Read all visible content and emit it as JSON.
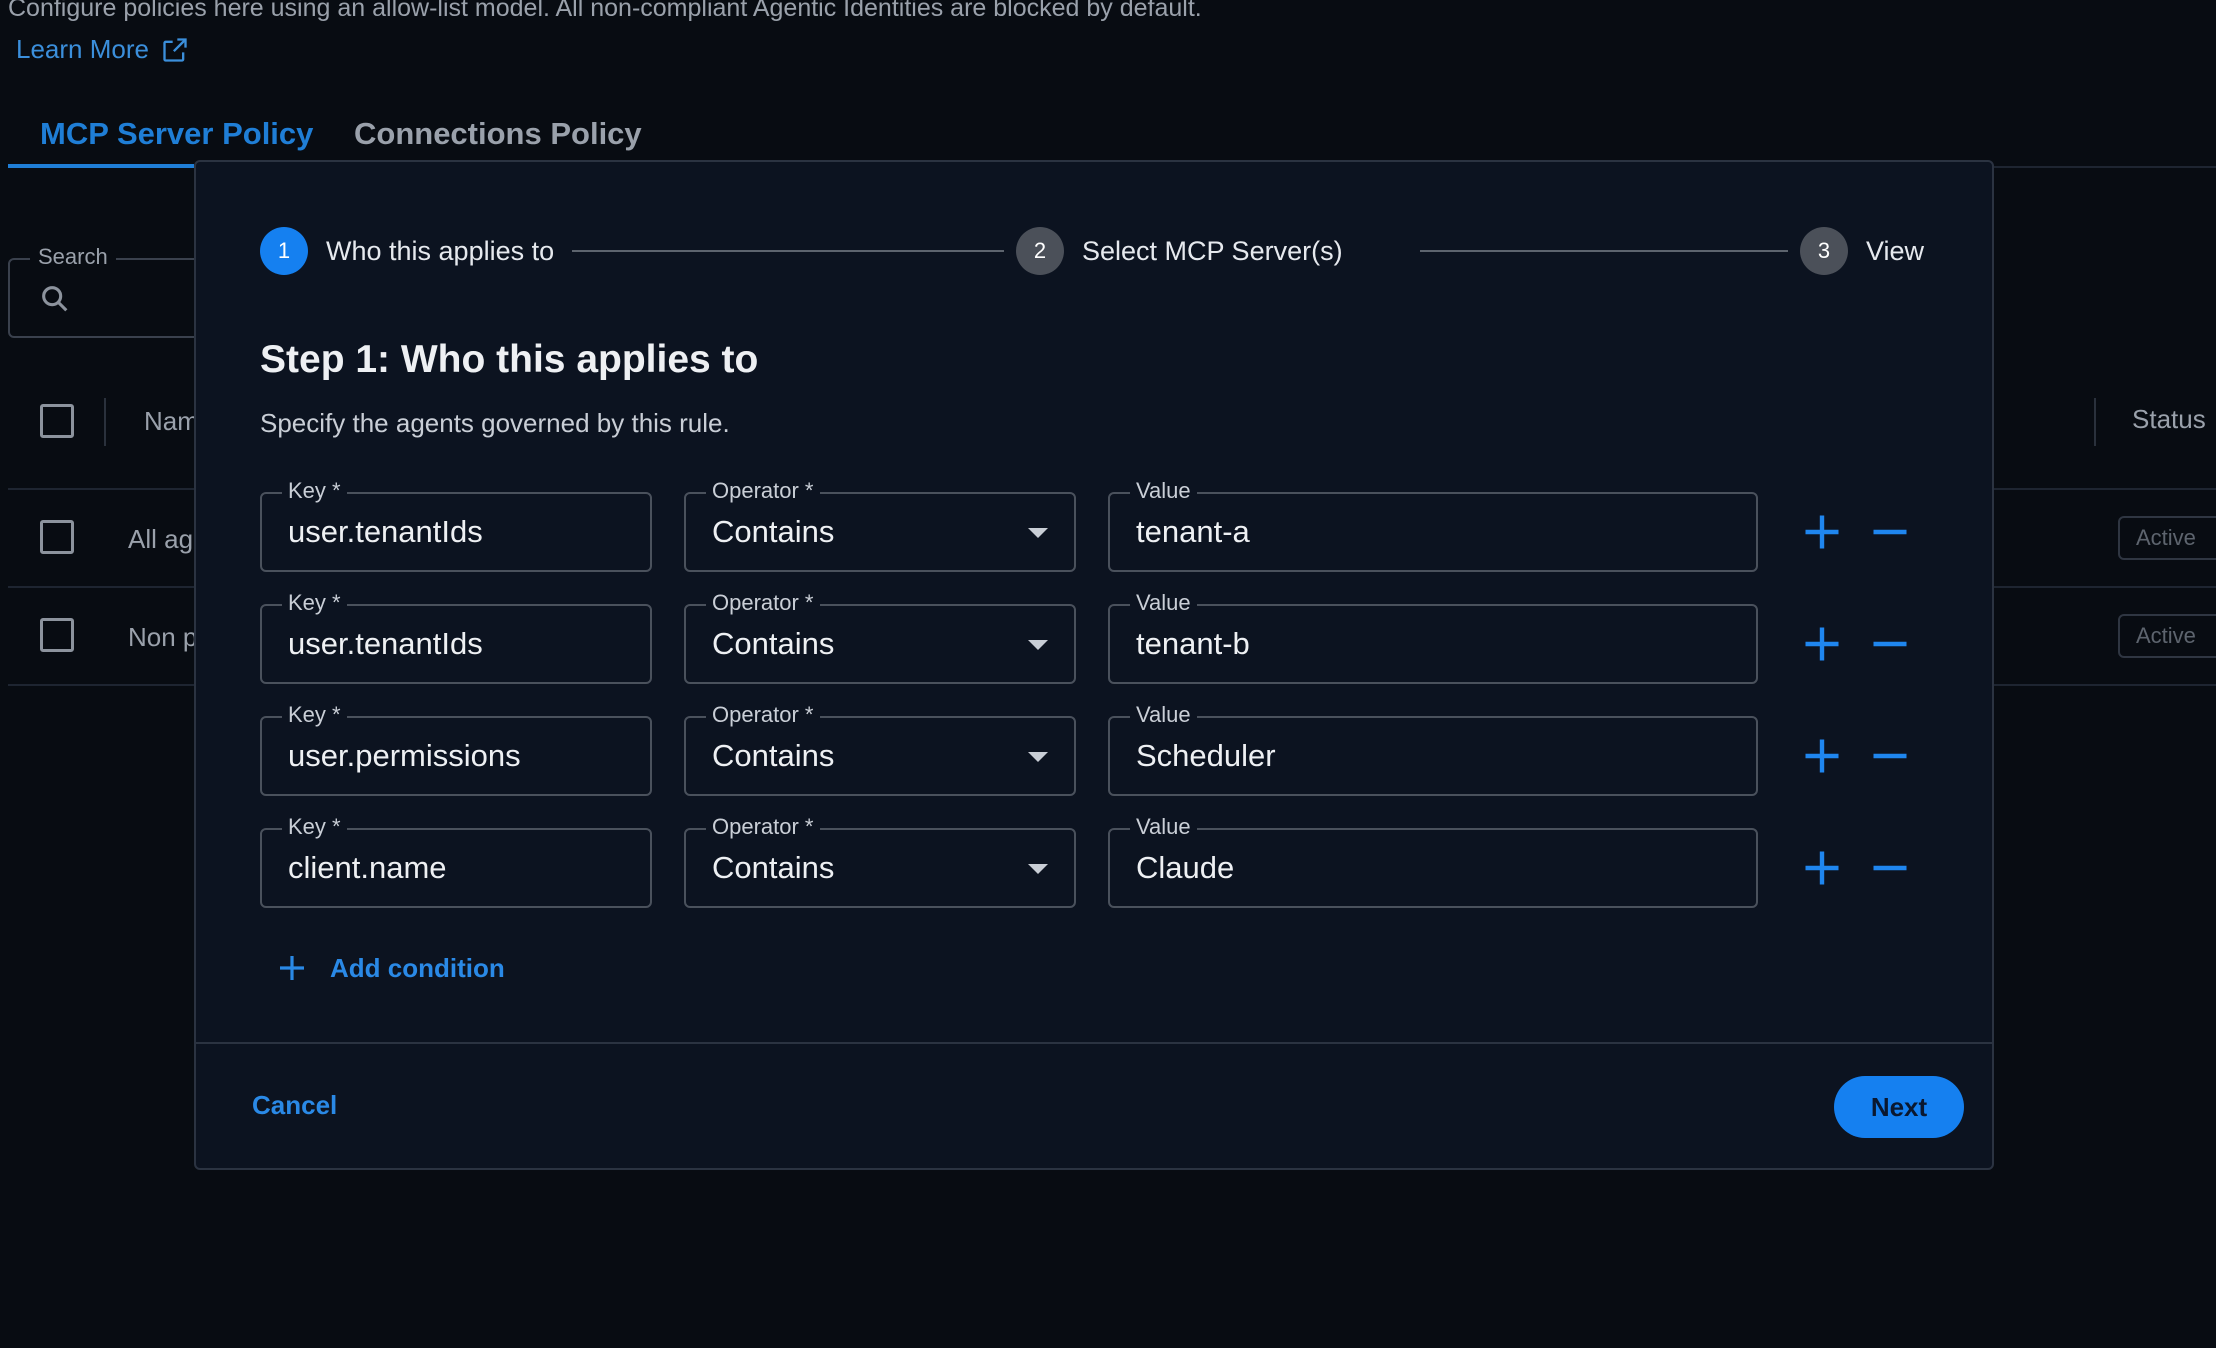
{
  "page": {
    "intro_text": "Configure policies here using an allow-list model. All non-compliant Agentic Identities are blocked by default.",
    "learn_more": "Learn More",
    "tabs": [
      {
        "label": "MCP Server Policy",
        "active": true
      },
      {
        "label": "Connections Policy",
        "active": false
      }
    ],
    "search_label": "Search",
    "table": {
      "header_name": "Nam",
      "header_status": "Status",
      "rows": [
        {
          "name": "All ag",
          "status": "Active"
        },
        {
          "name": "Non p",
          "status": "Active"
        }
      ]
    }
  },
  "modal": {
    "steps": [
      {
        "number": "1",
        "label": "Who this applies to",
        "state": "active"
      },
      {
        "number": "2",
        "label": "Select MCP Server(s)",
        "state": "inactive"
      },
      {
        "number": "3",
        "label": "View",
        "state": "inactive"
      }
    ],
    "title": "Step 1: Who this applies to",
    "subtitle": "Specify the agents governed by this rule.",
    "field_labels": {
      "key": "Key *",
      "operator": "Operator *",
      "value": "Value"
    },
    "conditions": [
      {
        "key": "user.tenantIds",
        "operator": "Contains",
        "value": "tenant-a"
      },
      {
        "key": "user.tenantIds",
        "operator": "Contains",
        "value": "tenant-b"
      },
      {
        "key": "user.permissions",
        "operator": "Contains",
        "value": "Scheduler"
      },
      {
        "key": "client.name",
        "operator": "Contains",
        "value": "Claude"
      }
    ],
    "add_condition": "Add condition",
    "cancel": "Cancel",
    "next": "Next"
  },
  "colors": {
    "accent": "#1580f0",
    "link": "#2a89e6",
    "background": "#080c12",
    "modal_background": "#0c1320"
  },
  "icons": {
    "learn_more": "external-link-icon",
    "search": "search-icon",
    "add": "plus-icon",
    "remove": "minus-icon",
    "dropdown": "caret-down-icon"
  }
}
